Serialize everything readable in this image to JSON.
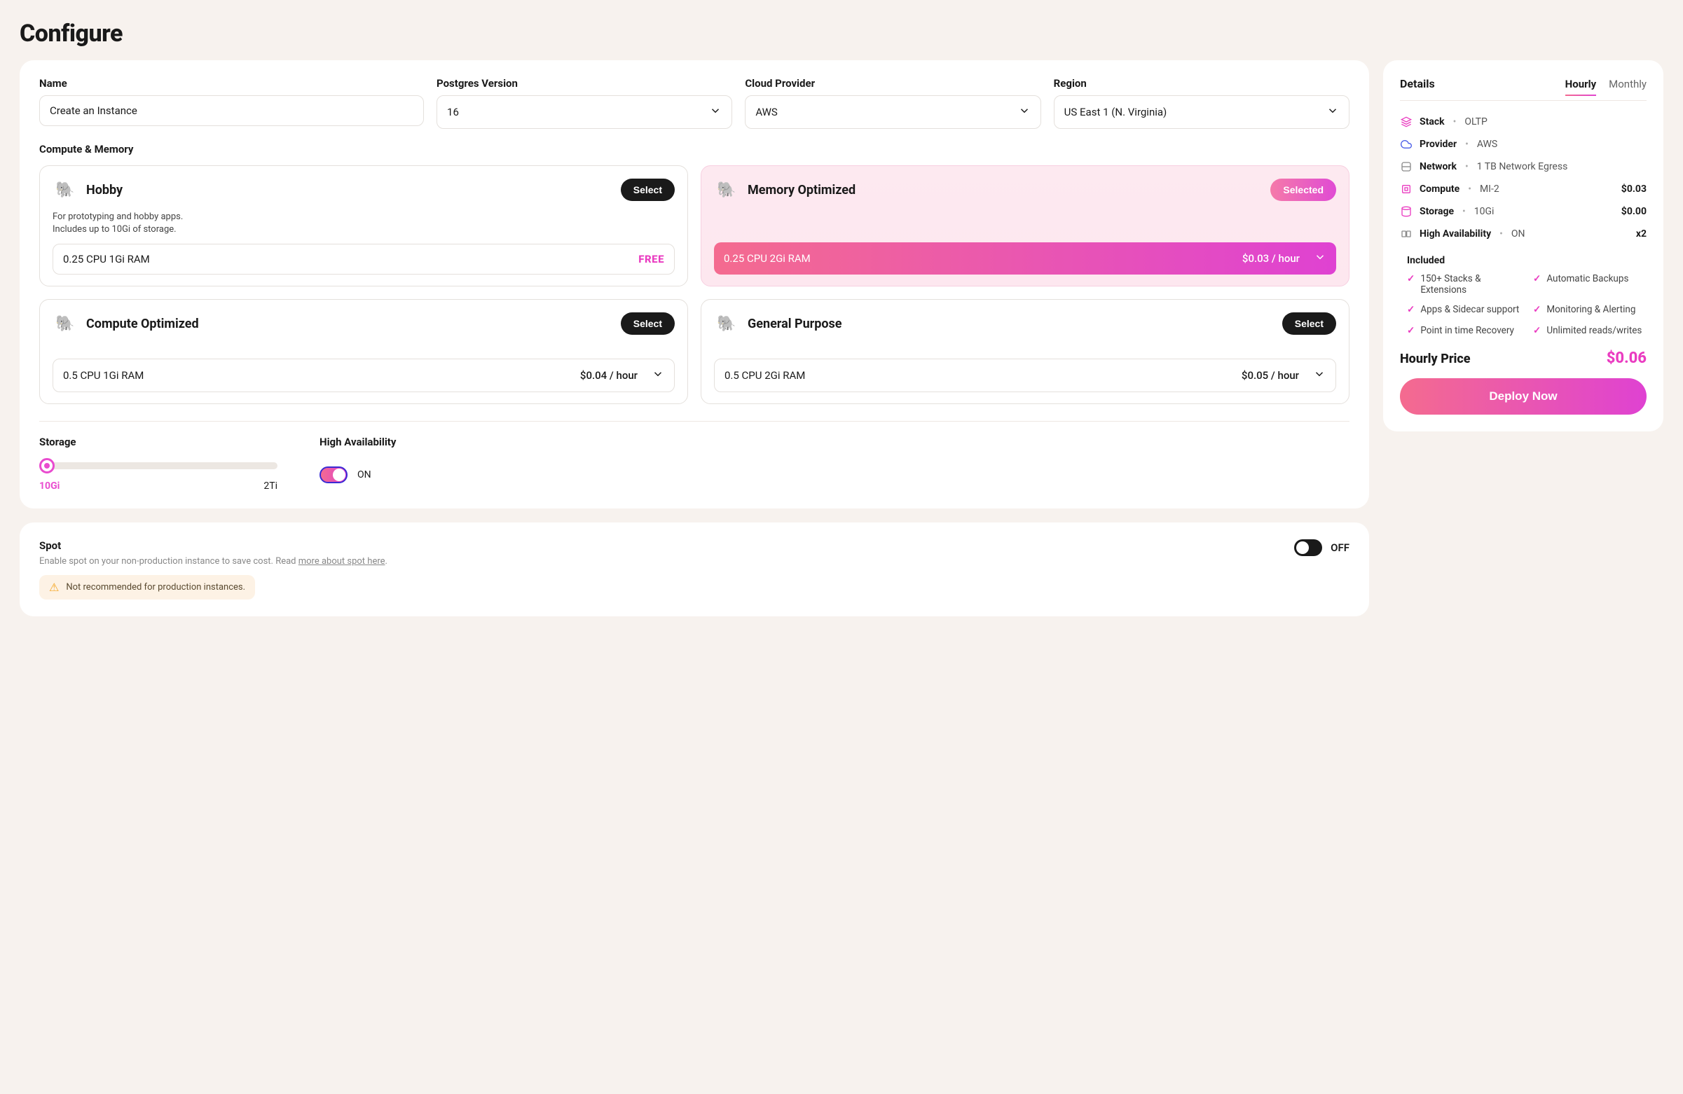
{
  "page_title": "Configure",
  "fields": {
    "name": {
      "label": "Name",
      "value": "Create an Instance"
    },
    "pg": {
      "label": "Postgres Version",
      "value": "16"
    },
    "cloud": {
      "label": "Cloud Provider",
      "value": "AWS"
    },
    "region": {
      "label": "Region",
      "value": "US East 1 (N. Virginia)"
    }
  },
  "compute": {
    "section_label": "Compute & Memory",
    "select_label": "Select",
    "selected_label": "Selected",
    "tiers": {
      "hobby": {
        "name": "Hobby",
        "desc1": "For prototyping and hobby apps.",
        "desc2": "Includes up to 10Gi of storage.",
        "spec": "0.25 CPU 1Gi RAM",
        "price": "FREE"
      },
      "memory": {
        "name": "Memory Optimized",
        "spec": "0.25 CPU 2Gi RAM",
        "price": "$0.03 / hour"
      },
      "compute_opt": {
        "name": "Compute Optimized",
        "spec": "0.5 CPU 1Gi RAM",
        "price": "$0.04 / hour"
      },
      "general": {
        "name": "General Purpose",
        "spec": "0.5 CPU 2Gi RAM",
        "price": "$0.05 / hour"
      }
    }
  },
  "storage": {
    "label": "Storage",
    "min": "10Gi",
    "max": "2Ti"
  },
  "ha": {
    "label": "High Availability",
    "state": "ON"
  },
  "spot": {
    "title": "Spot",
    "desc_pre": "Enable spot on your non-production instance to save cost. Read ",
    "desc_link": "more about spot here",
    "desc_post": ".",
    "state": "OFF",
    "warning": "Not recommended for production instances."
  },
  "sidebar": {
    "title": "Details",
    "tabs": {
      "hourly": "Hourly",
      "monthly": "Monthly"
    },
    "rows": {
      "stack": {
        "key": "Stack",
        "val": "OLTP"
      },
      "provider": {
        "key": "Provider",
        "val": "AWS"
      },
      "network": {
        "key": "Network",
        "val": "1 TB Network Egress"
      },
      "compute": {
        "key": "Compute",
        "val": "MI-2",
        "price": "$0.03"
      },
      "storage": {
        "key": "Storage",
        "val": "10Gi",
        "price": "$0.00"
      },
      "ha": {
        "key": "High Availability",
        "val": "ON",
        "price": "x2"
      }
    },
    "included": {
      "title": "Included",
      "items": [
        "150+ Stacks & Extensions",
        "Automatic Backups",
        "Apps & Sidecar support",
        "Monitoring & Alerting",
        "Point in time Recovery",
        "Unlimited reads/writes"
      ]
    },
    "price_label": "Hourly Price",
    "price_value": "$0.06",
    "deploy": "Deploy Now"
  }
}
